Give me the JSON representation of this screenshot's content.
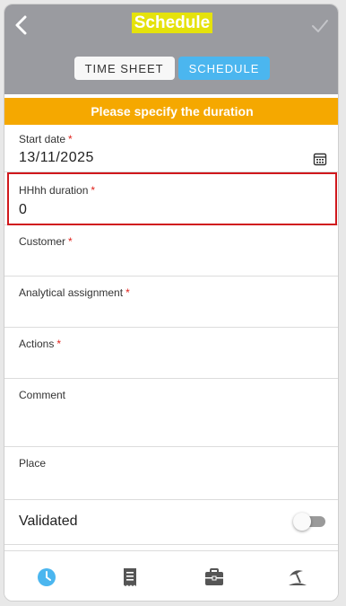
{
  "header": {
    "title": "Schedule",
    "back_icon": "chevron-left-icon",
    "confirm_icon": "check-icon",
    "colors": {
      "header_bg": "#9a9ba0",
      "title_highlight": "#e5e20c"
    }
  },
  "tabs": [
    {
      "label": "TIME SHEET",
      "active": false
    },
    {
      "label": "SCHEDULE",
      "active": true
    }
  ],
  "banner": {
    "text": "Please specify the duration",
    "color": "#f5a800"
  },
  "form": {
    "start_date": {
      "label": "Start date",
      "required_mark": "*",
      "value": "13/11/2025",
      "icon": "calendar-icon"
    },
    "duration": {
      "label": "HHhh duration",
      "required_mark": "*",
      "value": "0"
    },
    "customer": {
      "label": "Customer",
      "required_mark": "*",
      "value": ""
    },
    "analytical_assignment": {
      "label": "Analytical assignment",
      "required_mark": "*",
      "value": ""
    },
    "actions": {
      "label": "Actions",
      "required_mark": "*",
      "value": ""
    },
    "comment": {
      "label": "Comment",
      "value": ""
    },
    "place": {
      "label": "Place",
      "value": ""
    },
    "validated": {
      "label": "Validated",
      "value": false
    }
  },
  "bottom_nav": [
    {
      "icon": "clock-icon",
      "active": true
    },
    {
      "icon": "receipt-icon",
      "active": false
    },
    {
      "icon": "briefcase-icon",
      "active": false
    },
    {
      "icon": "beach-umbrella-icon",
      "active": false
    }
  ],
  "colors": {
    "accent": "#4bb6ef",
    "required": "#e0211b",
    "error_outline": "#d0191d"
  }
}
